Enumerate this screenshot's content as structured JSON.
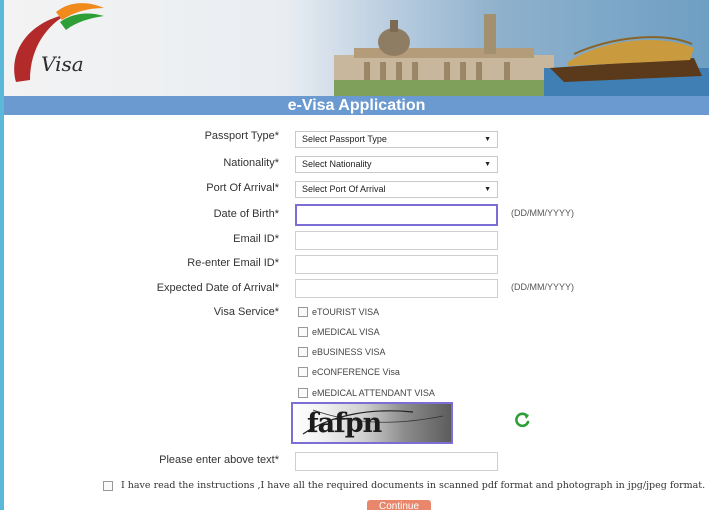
{
  "header": {
    "logo_text": "Visa",
    "title": "e-Visa Application"
  },
  "form": {
    "passport_type": {
      "label": "Passport Type*",
      "value": "Select Passport Type"
    },
    "nationality": {
      "label": "Nationality*",
      "value": "Select Nationality"
    },
    "port_of_arrival": {
      "label": "Port Of Arrival*",
      "value": "Select Port Of Arrival"
    },
    "dob": {
      "label": "Date of Birth*",
      "value": "",
      "hint": "(DD/MM/YYYY)"
    },
    "email": {
      "label": "Email ID*",
      "value": ""
    },
    "reemail": {
      "label": "Re-enter Email ID*",
      "value": ""
    },
    "arrival_date": {
      "label": "Expected Date of Arrival*",
      "value": "",
      "hint": "(DD/MM/YYYY)"
    },
    "visa_service": {
      "label": "Visa Service*",
      "options": [
        "eTOURIST VISA",
        "eMEDICAL VISA",
        "eBUSINESS VISA",
        "eCONFERENCE Visa",
        "eMEDICAL ATTENDANT VISA"
      ]
    },
    "captcha": {
      "text": "fafpn",
      "label": "Please enter above text*",
      "value": ""
    },
    "declaration": "I have read the instructions ,I have all the required documents in scanned pdf format and photograph in jpg/jpeg format.",
    "submit_label": "Continue"
  },
  "colors": {
    "title_bar": "#6a9ad0",
    "focus_border": "#7b6fd6",
    "submit": "#e8876c",
    "refresh_icon": "#2e9e36"
  }
}
